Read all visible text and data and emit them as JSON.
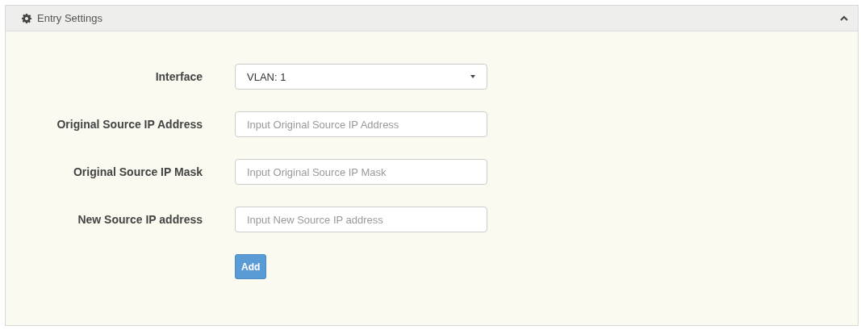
{
  "panel": {
    "title": "Entry Settings",
    "expanded": true
  },
  "fields": [
    {
      "kind": "select",
      "label": "Interface",
      "value": "VLAN: 1"
    },
    {
      "kind": "text",
      "label": "Original Source IP Address",
      "placeholder": "Input Original Source IP Address"
    },
    {
      "kind": "text",
      "label": "Original Source IP Mask",
      "placeholder": "Input Original Source IP Mask"
    },
    {
      "kind": "text",
      "label": "New Source IP address",
      "placeholder": "Input New Source IP address"
    }
  ],
  "buttons": [
    "Add"
  ]
}
